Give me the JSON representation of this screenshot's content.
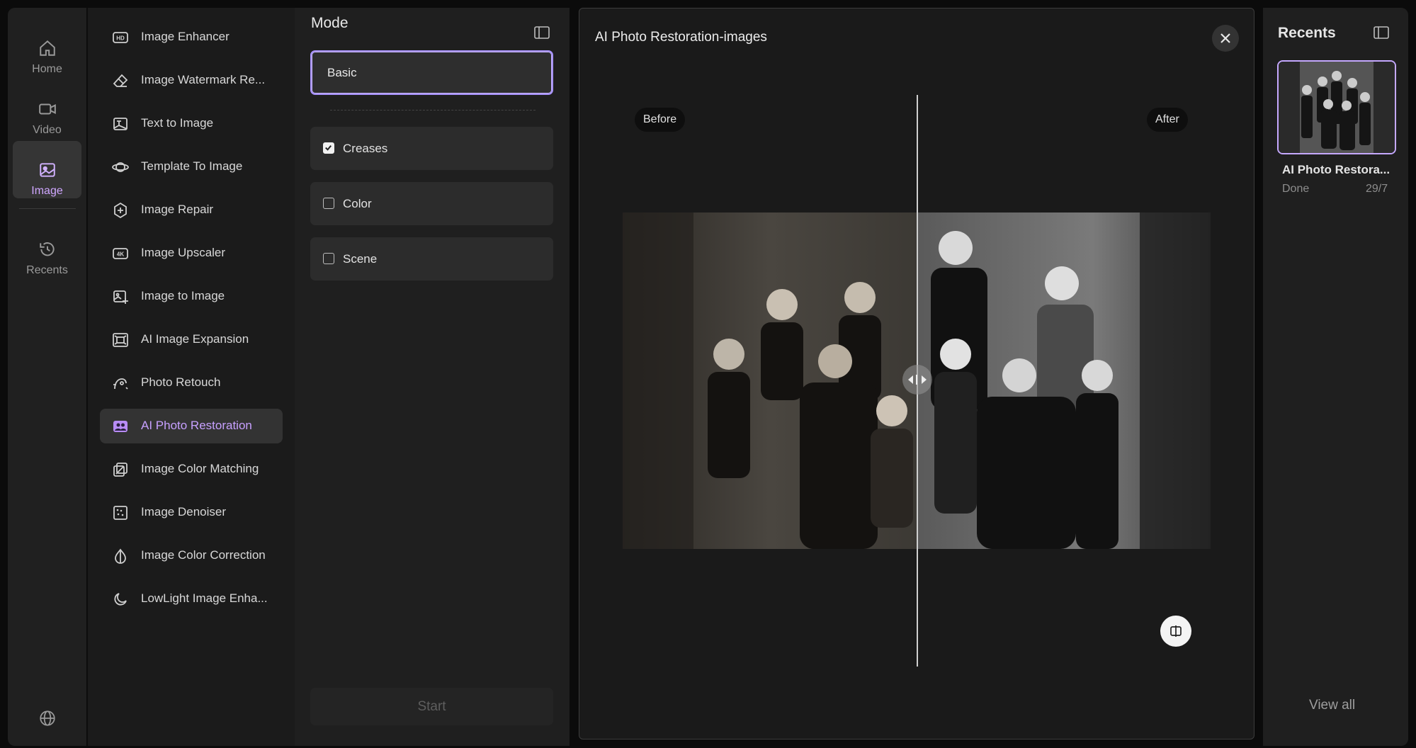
{
  "nav": {
    "items": [
      {
        "label": "Home",
        "icon": "home-icon",
        "active": false
      },
      {
        "label": "Video",
        "icon": "video-icon",
        "active": false
      },
      {
        "label": "Image",
        "icon": "image-icon",
        "active": true
      },
      {
        "label": "Recents",
        "icon": "history-icon",
        "active": false
      }
    ],
    "footer_icon": "globe-icon"
  },
  "tools": {
    "items": [
      {
        "label": "Image Enhancer",
        "icon": "hd-icon"
      },
      {
        "label": "Image Watermark Re...",
        "icon": "eraser-icon"
      },
      {
        "label": "Text to Image",
        "icon": "text-image-icon"
      },
      {
        "label": "Template To Image",
        "icon": "template-icon"
      },
      {
        "label": "Image Repair",
        "icon": "repair-icon"
      },
      {
        "label": "Image Upscaler",
        "icon": "4k-icon"
      },
      {
        "label": "Image to Image",
        "icon": "image-to-image-icon"
      },
      {
        "label": "AI Image Expansion",
        "icon": "expand-icon"
      },
      {
        "label": "Photo Retouch",
        "icon": "retouch-icon"
      },
      {
        "label": "AI Photo Restoration",
        "icon": "restoration-icon",
        "active": true
      },
      {
        "label": "Image Color Matching",
        "icon": "color-match-icon"
      },
      {
        "label": "Image Denoiser",
        "icon": "denoise-icon"
      },
      {
        "label": "Image Color Correction",
        "icon": "color-correction-icon"
      },
      {
        "label": "LowLight Image Enha...",
        "icon": "moon-icon"
      }
    ]
  },
  "mode": {
    "title": "Mode",
    "selected": "Basic",
    "options": [
      {
        "label": "Creases",
        "checked": true
      },
      {
        "label": "Color",
        "checked": false
      },
      {
        "label": "Scene",
        "checked": false
      }
    ],
    "start_label": "Start"
  },
  "preview": {
    "title": "AI Photo Restoration-images",
    "before_label": "Before",
    "after_label": "After",
    "slider_position": 0.5
  },
  "recents": {
    "title": "Recents",
    "item": {
      "title": "AI Photo Restora...",
      "status": "Done",
      "date": "29/7"
    },
    "view_all": "View all"
  },
  "colors": {
    "accent": "#c7a0ff",
    "background": "#0b0b0b",
    "panel": "#1f1f1f"
  }
}
